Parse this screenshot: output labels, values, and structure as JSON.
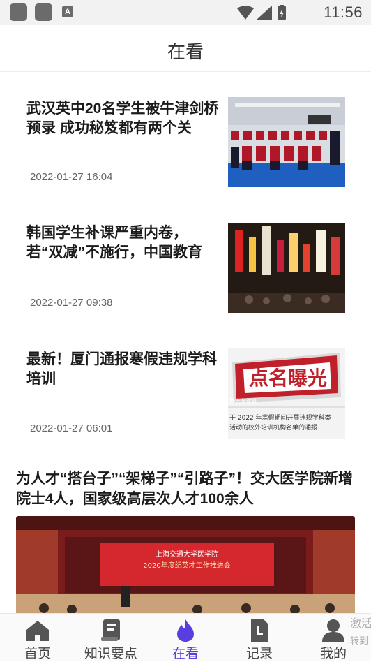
{
  "status_bar": {
    "time": "11:56",
    "icons": [
      "app-icon",
      "app-icon",
      "a-notification-icon",
      "wifi-icon",
      "signal-icon",
      "battery-icon"
    ]
  },
  "header": {
    "title": "在看"
  },
  "articles": [
    {
      "title": "武汉英中20名学生被牛津剑桥预录 成功秘笈都有两个关",
      "time": "2022-01-27 16:04"
    },
    {
      "title": "韩国学生补课严重内卷，若“双减”不施行，中国教育",
      "time": "2022-01-27 09:38"
    },
    {
      "title": "最新！厦门通报寒假违规学科培训",
      "time": "2022-01-27 06:01",
      "thumb_text": {
        "headline": "点名曝光",
        "caption_line1": "于 2022 年寒假期间开展违规学科类",
        "caption_line2": "活动的校外培训机构名单的通报",
        "tag": "励志友读社"
      }
    }
  ],
  "featured": {
    "title": "为人才“搭台子”“架梯子”“引路子”！交大医学院新增院士4人，国家级高层次人才100余人",
    "image_text": {
      "line1": "上海交通大学医学院",
      "line2": "2020年度纪英才工作推进会"
    }
  },
  "bottom_nav": {
    "items": [
      {
        "label": "首页",
        "icon": "home-icon"
      },
      {
        "label": "知识要点",
        "icon": "book-icon"
      },
      {
        "label": "在看",
        "icon": "flame-icon",
        "active": true
      },
      {
        "label": "记录",
        "icon": "record-icon"
      },
      {
        "label": "我的",
        "icon": "user-icon"
      }
    ]
  },
  "side_hint": {
    "line1": "激活",
    "line2": "转到"
  },
  "colors": {
    "accent": "#5a3fe0",
    "text": "#1b1b1b",
    "muted": "#666666"
  }
}
